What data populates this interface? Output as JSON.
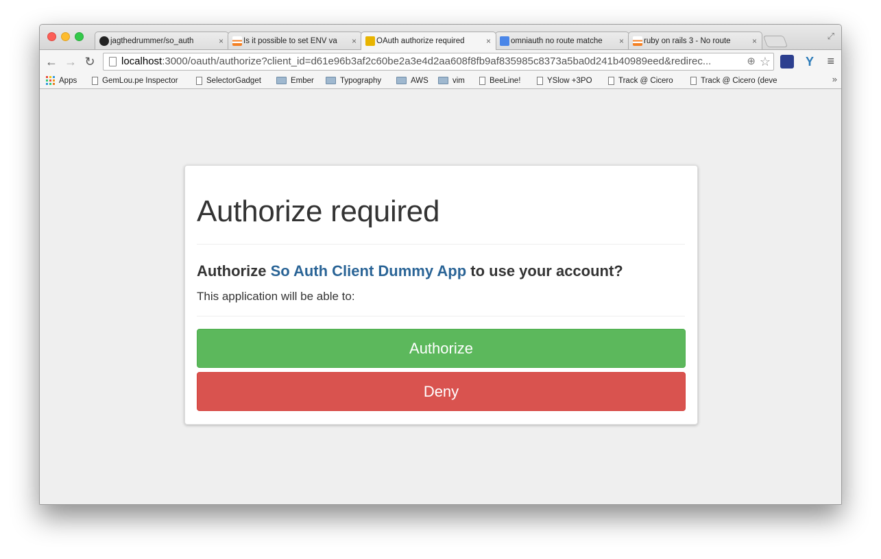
{
  "browser": {
    "tabs": [
      {
        "label": "jagthedrummer/so_auth",
        "icon": "github-icon",
        "icon_color": "#222222"
      },
      {
        "label": "Is it possible to set ENV va",
        "icon": "stackoverflow-icon",
        "icon_color": "#f48024"
      },
      {
        "label": "OAuth authorize required",
        "icon": "oauth-icon",
        "icon_color": "#e8b400"
      },
      {
        "label": "omniauth no route matche",
        "icon": "google-icon",
        "icon_color": "#4a86e8"
      },
      {
        "label": "ruby on rails 3 - No route",
        "icon": "stackoverflow-icon",
        "icon_color": "#f48024"
      }
    ],
    "tab_close": "×",
    "url_host": "localhost",
    "url_rest": ":3000/oauth/authorize?client_id=d61e96b3af2c60be2a3e4d2aa608f8fb9af835985c8373a5ba0d241b40989eed&redirec...",
    "bookmarks": [
      {
        "label": "Apps",
        "type": "apps"
      },
      {
        "label": "GemLou.pe Inspector",
        "type": "file"
      },
      {
        "label": "SelectorGadget",
        "type": "file"
      },
      {
        "label": "Ember",
        "type": "folder"
      },
      {
        "label": "Typography",
        "type": "folder"
      },
      {
        "label": "AWS",
        "type": "folder"
      },
      {
        "label": "vim",
        "type": "folder"
      },
      {
        "label": "BeeLine!",
        "type": "file"
      },
      {
        "label": "YSlow +3PO",
        "type": "file"
      },
      {
        "label": "Track @ Cicero",
        "type": "file"
      },
      {
        "label": "Track @ Cicero (deve",
        "type": "file"
      }
    ],
    "bookmarks_more": "»"
  },
  "page": {
    "title": "Authorize required",
    "prompt_prefix": "Authorize ",
    "app_name": "So Auth Client Dummy App",
    "prompt_suffix": " to use your account?",
    "description": "This application will be able to:",
    "authorize_label": "Authorize",
    "deny_label": "Deny"
  }
}
